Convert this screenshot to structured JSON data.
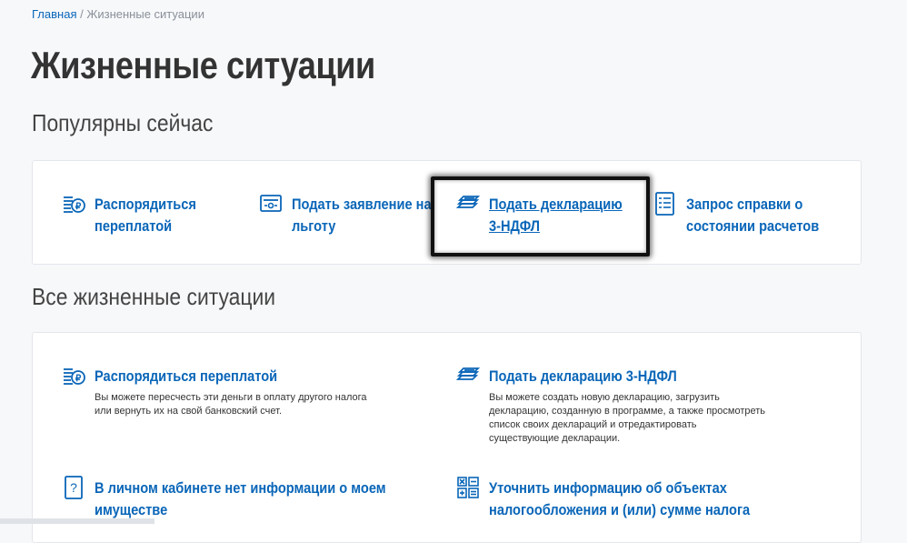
{
  "breadcrumb": {
    "home": "Главная",
    "separator": "/",
    "current": "Жизненные ситуации"
  },
  "page_title": "Жизненные ситуации",
  "popular": {
    "heading": "Популярны сейчас",
    "items": [
      {
        "line1": "Распорядиться",
        "line2": "переплатой",
        "icon": "ruble-coins-icon"
      },
      {
        "line1": "Подать заявление на",
        "line2": "льготу",
        "icon": "document-screen-icon"
      },
      {
        "line1": "Подать декларацию",
        "line2": "3-НДФЛ",
        "icon": "stacked-papers-icon"
      },
      {
        "line1": "Запрос справки о",
        "line2": "состоянии расчетов",
        "icon": "document-list-icon"
      }
    ]
  },
  "all": {
    "heading": "Все жизненные ситуации",
    "items": [
      {
        "line1": "Распорядиться переплатой",
        "line2": "",
        "desc": [
          "Вы можете пересчесть эти деньги в оплату другого налога",
          "или вернуть их на свой банковский счет."
        ],
        "icon": "ruble-coins-icon"
      },
      {
        "line1": "Подать декларацию 3-НДФЛ",
        "line2": "",
        "desc": [
          "Вы можете создать новую декларацию, загрузить",
          "декларацию, созданную в программе, а также просмотреть",
          "список своих деклараций и отредактировать",
          "существующие декларации."
        ],
        "icon": "stacked-papers-icon"
      },
      {
        "line1": "В личном кабинете нет информации о моем",
        "line2": "имуществе",
        "desc": [],
        "icon": "question-doc-icon"
      },
      {
        "line1": "Уточнить информацию об объектах",
        "line2": "налогообложения и (или) сумме налога",
        "desc": [],
        "icon": "calculator-icon"
      }
    ]
  },
  "colors": {
    "link": "#0a66b8",
    "title": "#333333",
    "background": "#f7f8fa"
  }
}
